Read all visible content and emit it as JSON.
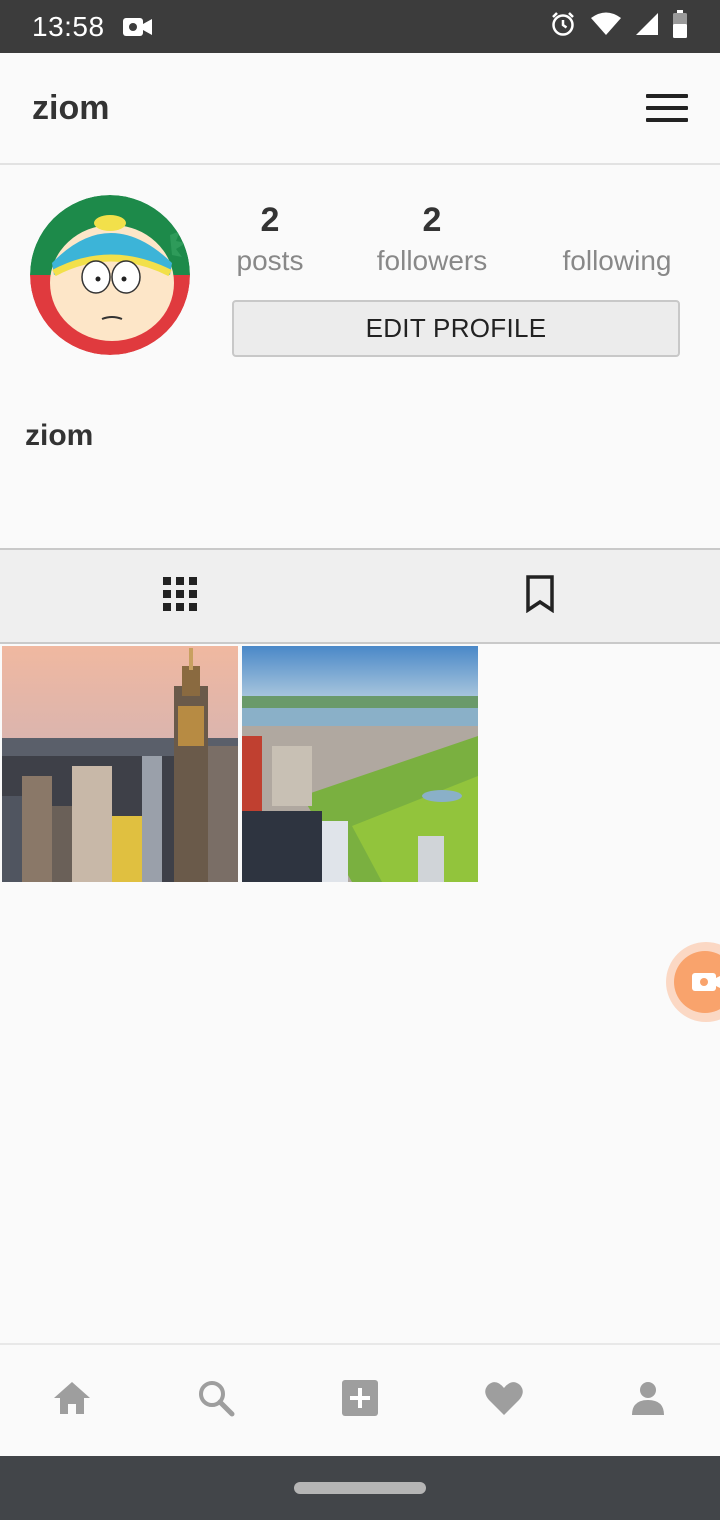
{
  "status_bar": {
    "time": "13:58",
    "icons": [
      "video-camera-icon",
      "alarm-icon",
      "wifi-icon",
      "signal-icon",
      "battery-icon"
    ]
  },
  "header": {
    "title": "ziom",
    "menu_icon": "hamburger-menu-icon"
  },
  "profile": {
    "avatar": "avatar-cartoon-character",
    "stats": [
      {
        "value": "2",
        "label": "posts"
      },
      {
        "value": "2",
        "label": "followers"
      },
      {
        "value": "",
        "label": "following"
      }
    ],
    "edit_button": "EDIT PROFILE",
    "name": "ziom"
  },
  "tabs": [
    {
      "icon": "grid-icon",
      "active": true
    },
    {
      "icon": "bookmark-icon",
      "active": false
    }
  ],
  "posts": [
    {
      "image": "city-skyline-empire-state"
    },
    {
      "image": "city-park-aerial"
    }
  ],
  "floating_button": {
    "icon": "video-camera-icon"
  },
  "bottom_nav": [
    "home-icon",
    "search-icon",
    "add-post-icon",
    "heart-icon",
    "profile-icon"
  ],
  "colors": {
    "status_bar": "#3c3c3c",
    "background": "#fafafa",
    "nav_icon": "#9e9e9e",
    "accent_float": "#f9a36c"
  }
}
